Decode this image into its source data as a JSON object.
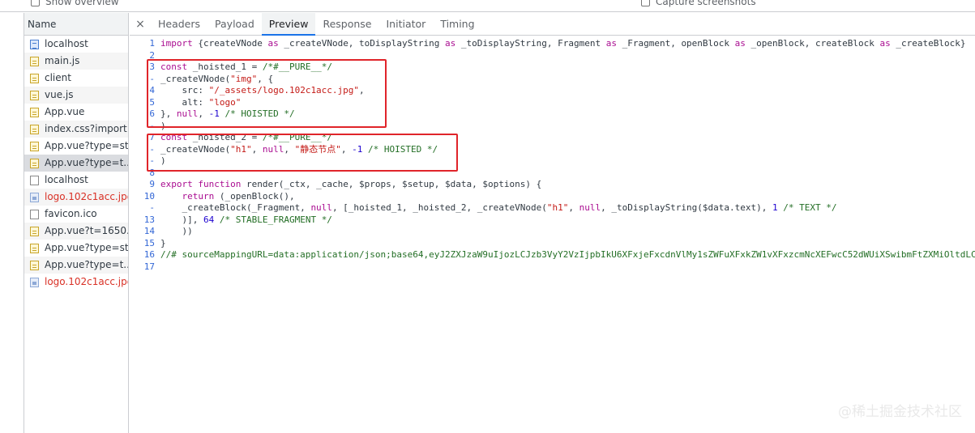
{
  "topbar": {
    "show_overview": "Show overview",
    "capture_screenshots": "Capture screenshots"
  },
  "name_column": {
    "header": "Name",
    "requests": [
      {
        "name": "localhost",
        "icon": "document-icon",
        "error": false
      },
      {
        "name": "main.js",
        "icon": "script-icon",
        "error": false
      },
      {
        "name": "client",
        "icon": "script-icon",
        "error": false
      },
      {
        "name": "vue.js",
        "icon": "script-icon",
        "error": false
      },
      {
        "name": "App.vue",
        "icon": "script-icon",
        "error": false
      },
      {
        "name": "index.css?import",
        "icon": "script-icon",
        "error": false
      },
      {
        "name": "App.vue?type=st...",
        "icon": "script-icon",
        "error": false
      },
      {
        "name": "App.vue?type=t...",
        "icon": "script-icon",
        "error": false,
        "selected": true
      },
      {
        "name": "localhost",
        "icon": "blank-icon",
        "error": false
      },
      {
        "name": "logo.102c1acc.jpg",
        "icon": "image-icon",
        "error": true
      },
      {
        "name": "favicon.ico",
        "icon": "blank-icon",
        "error": false
      },
      {
        "name": "App.vue?t=1650...",
        "icon": "script-icon",
        "error": false
      },
      {
        "name": "App.vue?type=st...",
        "icon": "script-icon",
        "error": false
      },
      {
        "name": "App.vue?type=t...",
        "icon": "script-icon",
        "error": false
      },
      {
        "name": "logo.102c1acc.jpg",
        "icon": "image-icon",
        "error": true
      }
    ]
  },
  "tabs": {
    "close": "×",
    "items": [
      "Headers",
      "Payload",
      "Preview",
      "Response",
      "Initiator",
      "Timing"
    ],
    "active": "Preview"
  },
  "code_lines": [
    {
      "n": "1",
      "tokens": [
        [
          "kw",
          "import"
        ],
        [
          "t",
          " {createVNode "
        ],
        [
          "kw",
          "as"
        ],
        [
          "t",
          " _createVNode, toDisplayString "
        ],
        [
          "kw",
          "as"
        ],
        [
          "t",
          " _toDisplayString, Fragment "
        ],
        [
          "kw",
          "as"
        ],
        [
          "t",
          " _Fragment, openBlock "
        ],
        [
          "kw",
          "as"
        ],
        [
          "t",
          " _openBlock, createBlock "
        ],
        [
          "kw",
          "as"
        ],
        [
          "t",
          " _createBlock} "
        ]
      ]
    },
    {
      "n": "2",
      "tokens": []
    },
    {
      "n": "3",
      "tokens": [
        [
          "kw",
          "const"
        ],
        [
          "t",
          " _hoisted_1 = "
        ],
        [
          "cm",
          "/*#__PURE__*/"
        ]
      ]
    },
    {
      "n": "-",
      "tokens": [
        [
          "t",
          "_createVNode("
        ],
        [
          "str",
          "\"img\""
        ],
        [
          "t",
          ", {"
        ]
      ]
    },
    {
      "n": "4",
      "tokens": [
        [
          "t",
          "    src: "
        ],
        [
          "str",
          "\"/_assets/logo.102c1acc.jpg\""
        ],
        [
          "t",
          ","
        ]
      ]
    },
    {
      "n": "5",
      "tokens": [
        [
          "t",
          "    alt: "
        ],
        [
          "str",
          "\"logo\""
        ]
      ]
    },
    {
      "n": "6",
      "tokens": [
        [
          "t",
          "}, "
        ],
        [
          "kw",
          "null"
        ],
        [
          "t",
          ", "
        ],
        [
          "num",
          "-1"
        ],
        [
          "t",
          " "
        ],
        [
          "cm",
          "/* HOISTED */"
        ]
      ]
    },
    {
      "n": "-",
      "tokens": [
        [
          "t",
          ")"
        ]
      ]
    },
    {
      "n": "7",
      "tokens": [
        [
          "kw",
          "const"
        ],
        [
          "t",
          " _hoisted_2 = "
        ],
        [
          "cm",
          "/*#__PURE__*/"
        ]
      ]
    },
    {
      "n": "-",
      "tokens": [
        [
          "t",
          "_createVNode("
        ],
        [
          "str",
          "\"h1\""
        ],
        [
          "t",
          ", "
        ],
        [
          "kw",
          "null"
        ],
        [
          "t",
          ", "
        ],
        [
          "str",
          "\"静态节点\""
        ],
        [
          "t",
          ", "
        ],
        [
          "num",
          "-1"
        ],
        [
          "t",
          " "
        ],
        [
          "cm",
          "/* HOISTED */"
        ]
      ]
    },
    {
      "n": "-",
      "tokens": [
        [
          "t",
          ")"
        ]
      ]
    },
    {
      "n": "8",
      "tokens": []
    },
    {
      "n": "9",
      "tokens": [
        [
          "kw",
          "export"
        ],
        [
          "t",
          " "
        ],
        [
          "kw",
          "function"
        ],
        [
          "t",
          " render(_ctx, _cache, $props, $setup, $data, $options) {"
        ]
      ]
    },
    {
      "n": "10",
      "tokens": [
        [
          "t",
          "    "
        ],
        [
          "kw",
          "return"
        ],
        [
          "t",
          " (_openBlock(),"
        ]
      ]
    },
    {
      "n": "-",
      "tokens": [
        [
          "t",
          "    _createBlock(_Fragment, "
        ],
        [
          "kw",
          "null"
        ],
        [
          "t",
          ", [_hoisted_1, _hoisted_2, _createVNode("
        ],
        [
          "str",
          "\"h1\""
        ],
        [
          "t",
          ", "
        ],
        [
          "kw",
          "null"
        ],
        [
          "t",
          ", _toDisplayString($data.text), "
        ],
        [
          "num",
          "1"
        ],
        [
          "t",
          " "
        ],
        [
          "cm",
          "/* TEXT */"
        ]
      ]
    },
    {
      "n": "13",
      "tokens": [
        [
          "t",
          "    )], "
        ],
        [
          "num",
          "64"
        ],
        [
          "t",
          " "
        ],
        [
          "cm",
          "/* STABLE_FRAGMENT */"
        ]
      ]
    },
    {
      "n": "14",
      "tokens": [
        [
          "t",
          "    ))"
        ]
      ]
    },
    {
      "n": "15",
      "tokens": [
        [
          "t",
          "}"
        ]
      ]
    },
    {
      "n": "16",
      "tokens": [
        [
          "cm",
          "//# sourceMappingURL=data:application/json;base64,eyJ2ZXJzaW9uIjozLCJzb3VyY2VzIjpbIkU6XFxjeFxcdnVlMy1sZWFuXFxkZW1vXFxzcmNcXEFwcC52dWUiXSwibmFtZXMiOltdLCJtYXBwaW5ncyI6Ijs7O"
        ]
      ]
    },
    {
      "n": "17",
      "tokens": []
    }
  ],
  "watermark": "@稀土掘金技术社区",
  "colors": {
    "highlight_box": "#e0242a",
    "active_tab_underline": "#1a73e8",
    "error_text": "#d93025"
  }
}
